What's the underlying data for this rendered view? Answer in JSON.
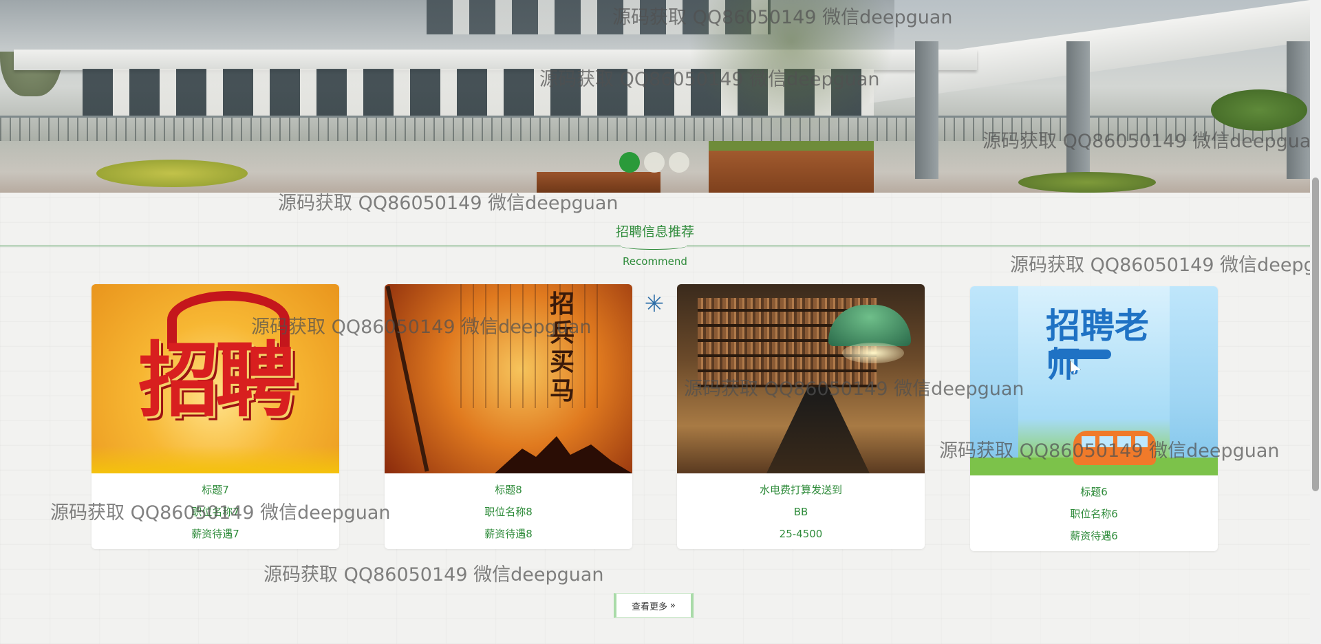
{
  "banner": {
    "slides_total": 3,
    "active_slide": 1
  },
  "section": {
    "title": "招聘信息推荐",
    "subtitle": "Recommend"
  },
  "cards": [
    {
      "line1": "标题7",
      "line2": "职位名称7",
      "line3": "薪资待遇7"
    },
    {
      "line1": "标题8",
      "line2": "职位名称8",
      "line3": "薪资待遇8"
    },
    {
      "line1": "水电费打算发送到",
      "line2": "BB",
      "line3": "25-4500"
    },
    {
      "line1": "标题6",
      "line2": "职位名称6",
      "line3": "薪资待遇6"
    }
  ],
  "card_image_text": {
    "card1": "招聘",
    "card2": "招兵买马",
    "card4": "招聘老师"
  },
  "more_button": {
    "label": "查看更多",
    "icon": "»"
  },
  "watermark": "源码获取 QQ86050149 微信deepguan",
  "colors": {
    "accent_green": "#2e8b3a",
    "active_dot": "#2a9a3a"
  }
}
